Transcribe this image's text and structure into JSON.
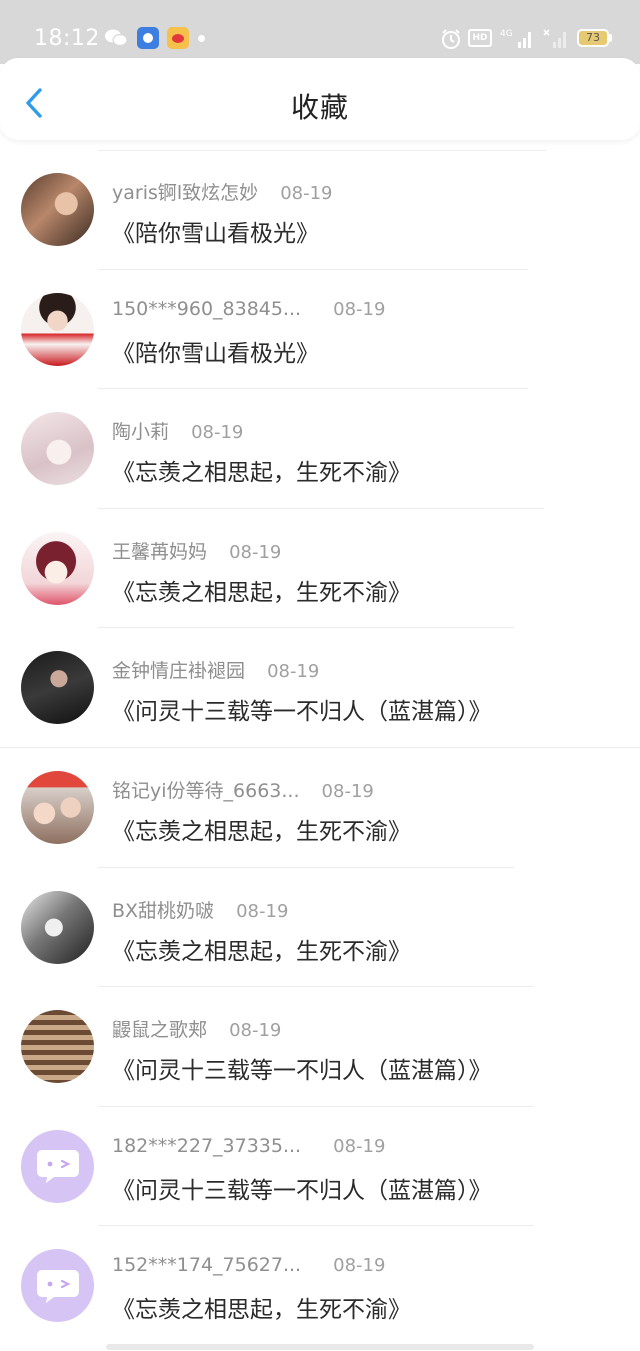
{
  "status_bar": {
    "time": "18:12",
    "battery": "73",
    "hd_label": "HD",
    "icons": [
      "wechat-icon",
      "app-icon",
      "weibo-icon",
      "alarm-icon",
      "signal-4g-icon",
      "signal-icon",
      "battery-icon"
    ]
  },
  "header": {
    "title": "收藏",
    "back_icon": "chevron-left-icon"
  },
  "colors": {
    "accent": "#2f9ceb",
    "status_bar_bg": "#d8d8d8",
    "avatar_placeholder": "#d6c4f4"
  },
  "items": [
    {
      "username": "yaris锕l致炫怎妙",
      "date": "08-19",
      "title": "《陪你雪山看极光》"
    },
    {
      "username": "150***960_83845...",
      "date": "08-19",
      "title": "《陪你雪山看极光》"
    },
    {
      "username": "陶小莉",
      "date": "08-19",
      "title": "《忘羡之相思起，生死不渝》"
    },
    {
      "username": "王馨苒妈妈",
      "date": "08-19",
      "title": "《忘羡之相思起，生死不渝》"
    },
    {
      "username": "金钟情庄褂褪园",
      "date": "08-19",
      "title": "《问灵十三载等一不归人（蓝湛篇）》"
    },
    {
      "username": "铭记yi份等待_6663...",
      "date": "08-19",
      "title": "《忘羡之相思起，生死不渝》"
    },
    {
      "username": "BX甜桃奶啵",
      "date": "08-19",
      "title": "《忘羡之相思起，生死不渝》"
    },
    {
      "username": "鼹鼠之歌郏",
      "date": "08-19",
      "title": "《问灵十三载等一不归人（蓝湛篇）》"
    },
    {
      "username": "182***227_37335...",
      "date": "08-19",
      "title": "《问灵十三载等一不归人（蓝湛篇）》"
    },
    {
      "username": "152***174_75627...",
      "date": "08-19",
      "title": "《忘羡之相思起，生死不渝》"
    }
  ]
}
